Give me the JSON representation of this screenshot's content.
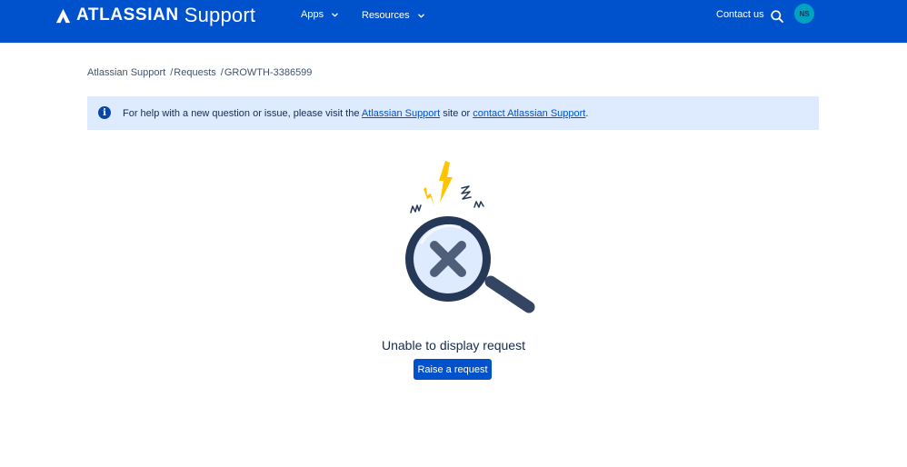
{
  "header": {
    "brand": "ATLASSIAN",
    "product": "Support",
    "nav": [
      {
        "label": "Apps"
      },
      {
        "label": "Resources"
      }
    ],
    "contact_label": "Contact us",
    "avatar_initials": "NS",
    "colors": {
      "background": "#0052cc",
      "avatar": "#00a3bf"
    }
  },
  "breadcrumb": [
    {
      "label": "Atlassian Support"
    },
    {
      "label": "Requests"
    },
    {
      "label": "GROWTH-3386599"
    }
  ],
  "breadcrumb_separator": "/",
  "banner": {
    "icon": "info-icon",
    "text_before": "For help with a new question or issue, please visit the ",
    "link1": "Atlassian Support",
    "text_middle": " site or ",
    "link2": "contact Atlassian Support",
    "text_after": ".",
    "background": "#deebff"
  },
  "empty_state": {
    "illustration": "magnifier-x-icon",
    "title": "Unable to display request",
    "button_label": "Raise a request"
  }
}
